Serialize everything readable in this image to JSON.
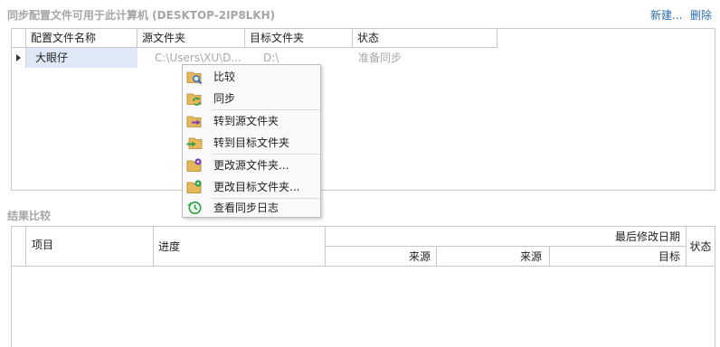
{
  "header": {
    "title": "同步配置文件可用于此计算机 (DESKTOP-2IP8LKH)",
    "new_label": "新建...",
    "delete_label": "删除"
  },
  "sync_table": {
    "columns": [
      "配置文件名称",
      "源文件夹",
      "目标文件夹",
      "状态"
    ],
    "rows": [
      {
        "name": "大眼仔",
        "source": "C:\\Users\\XU\\D...",
        "target": "D:\\",
        "status": "准备同步"
      }
    ]
  },
  "context_menu": {
    "items": [
      {
        "label": "比较",
        "icon": "folder-magnifier-icon"
      },
      {
        "label": "同步",
        "icon": "folder-sync-icon"
      },
      {
        "label": "转到源文件夹",
        "icon": "folder-arrow-icon"
      },
      {
        "label": "转到目标文件夹",
        "icon": "folder-arrow-in-icon"
      },
      {
        "label": "更改源文件夹...",
        "icon": "folder-edit-icon"
      },
      {
        "label": "更改目标文件夹...",
        "icon": "folder-edit-target-icon"
      },
      {
        "label": "查看同步日志",
        "icon": "history-clock-icon"
      }
    ]
  },
  "results": {
    "title": "结果比较",
    "col_item": "项目",
    "col_progress": "进度",
    "col_last_modified": "最后修改日期",
    "col_source_a": "来源",
    "col_source_b": "来源",
    "col_target": "目标",
    "col_status": "状态"
  },
  "colors": {
    "link": "#2b6cae",
    "muted_title": "#a6a6a6",
    "selected_row": "#dfe8f6",
    "grid_line": "#c8c8c8"
  }
}
